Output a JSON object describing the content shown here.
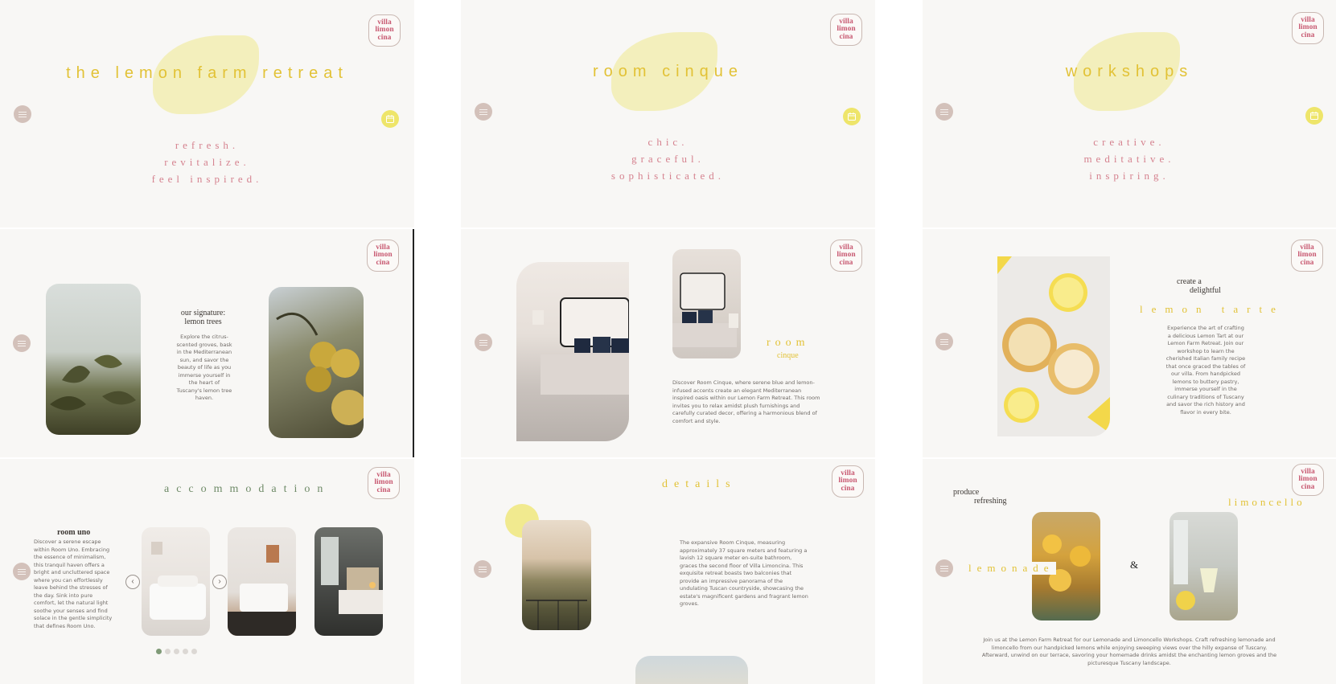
{
  "brand": {
    "logo_lines": [
      "villa",
      "limon",
      "cina"
    ],
    "accent": "#e2c236",
    "rose": "#d5828f"
  },
  "hero": {
    "title": "the lemon farm retreat",
    "tagline": [
      "refresh.",
      "revitalize.",
      "feel inspired."
    ]
  },
  "room_cinque_hero": {
    "title": "room cinque",
    "tagline": [
      "chic.",
      "graceful.",
      "sophisticated."
    ]
  },
  "workshops_hero": {
    "title": "workshops",
    "tagline": [
      "creative.",
      "meditative.",
      "inspiring."
    ]
  },
  "signature": {
    "heading_line1": "our signature:",
    "heading_line2": "lemon trees",
    "body": "Explore the citrus-scented groves, bask in the Mediterranean sun, and savor the beauty of life as you immerse yourself in the heart of Tuscany's lemon tree haven."
  },
  "room_cinque_intro": {
    "title": "room",
    "subtitle": "cinque",
    "body": "Discover Room Cinque, where serene blue and lemon-infused accents create an elegant Mediterranean inspired oasis within our Lemon Farm Retreat. This room invites you to relax amidst plush furnishings and carefully curated decor, offering a harmonious blend of comfort and style."
  },
  "lemon_tarte": {
    "heading_line1": "create a",
    "heading_line2": "delightful",
    "title": "lemon tarte",
    "body": "Experience the art of crafting a delicious Lemon Tart at our Lemon Farm Retreat. Join our workshop to learn the cherished Italian family recipe that once graced the tables of our villa. From handpicked lemons to buttery pastry, immerse yourself in the culinary traditions of Tuscany and savor the rich history and flavor in every bite."
  },
  "accommodation": {
    "title": "accommodation",
    "room_name": "room uno",
    "body": "Discover a serene escape within Room Uno. Embracing the essence of minimalism, this tranquil haven offers a bright and uncluttered space where you can effortlessly leave behind the stresses of the day. Sink into pure comfort, let the natural light soothe your senses and find solace in the gentle simplicity that defines Room Uno.",
    "prev_icon": "chevron-left-icon",
    "next_icon": "chevron-right-icon",
    "active_slide": 1,
    "slide_count": 5,
    "prev_label": "‹",
    "next_label": "›"
  },
  "details": {
    "title": "details",
    "body": "The expansive Room Cinque, measuring approximately 37 square meters and featuring a lavish 12 square meter en-suite bathroom, graces the second floor of Villa Limoncina. This exquisite retreat boasts two balconies that provide an impressive panorama of the undulating Tuscan countryside, showcasing the estate's magnificent gardens and fragrant lemon groves."
  },
  "produce": {
    "heading_line1": "produce",
    "heading_line2": "refreshing",
    "left_word": "lemonade",
    "ampersand": "&",
    "right_word": "limoncello",
    "body": "Join us at the Lemon Farm Retreat for our Lemonade and Limoncello Workshops. Craft refreshing lemonade and limoncello from our handpicked lemons while enjoying sweeping views over the hilly expanse of Tuscany. Afterward, unwind on our terrace, savoring your homemade drinks amidst the enchanting lemon groves and the picturesque Tuscany landscape."
  }
}
